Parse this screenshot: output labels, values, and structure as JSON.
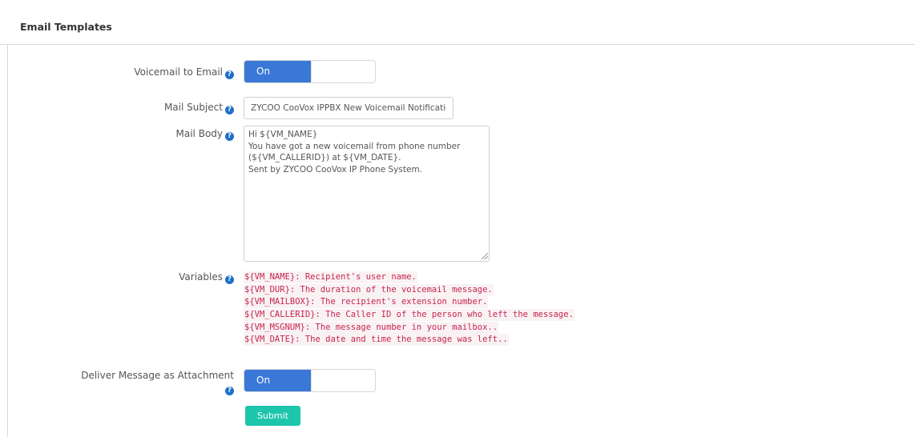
{
  "panel": {
    "title": "Email Templates"
  },
  "voicemail_to_email": {
    "label": "Voicemail to Email",
    "toggle_label": "On"
  },
  "mail_subject": {
    "label": "Mail Subject",
    "value": "ZYCOO CooVox IPPBX New Voicemail Notification"
  },
  "mail_body": {
    "label": "Mail Body",
    "value": "Hi ${VM_NAME}\nYou have got a new voicemail from phone number (${VM_CALLERID}) at ${VM_DATE}.\nSent by ZYCOO CooVox IP Phone System."
  },
  "variables": {
    "label": "Variables",
    "items": [
      "${VM_NAME}: Recipient's user name.",
      "${VM_DUR}: The duration of the voicemail message.",
      "${VM_MAILBOX}: The recipient's extension number.",
      "${VM_CALLERID}: The Caller ID of the person who left the message.",
      "${VM_MSGNUM}: The message number in your mailbox..",
      "${VM_DATE}: The date and time the message was left.."
    ]
  },
  "deliver_attachment": {
    "label_line1": "Deliver Message as Attachment",
    "toggle_label": "On"
  },
  "submit": {
    "label": "Submit"
  },
  "icons": {
    "help": "question-circle-icon"
  },
  "colors": {
    "accent": "#3a78d8",
    "submit": "#1ec5ad",
    "code_text": "#c7254e"
  }
}
